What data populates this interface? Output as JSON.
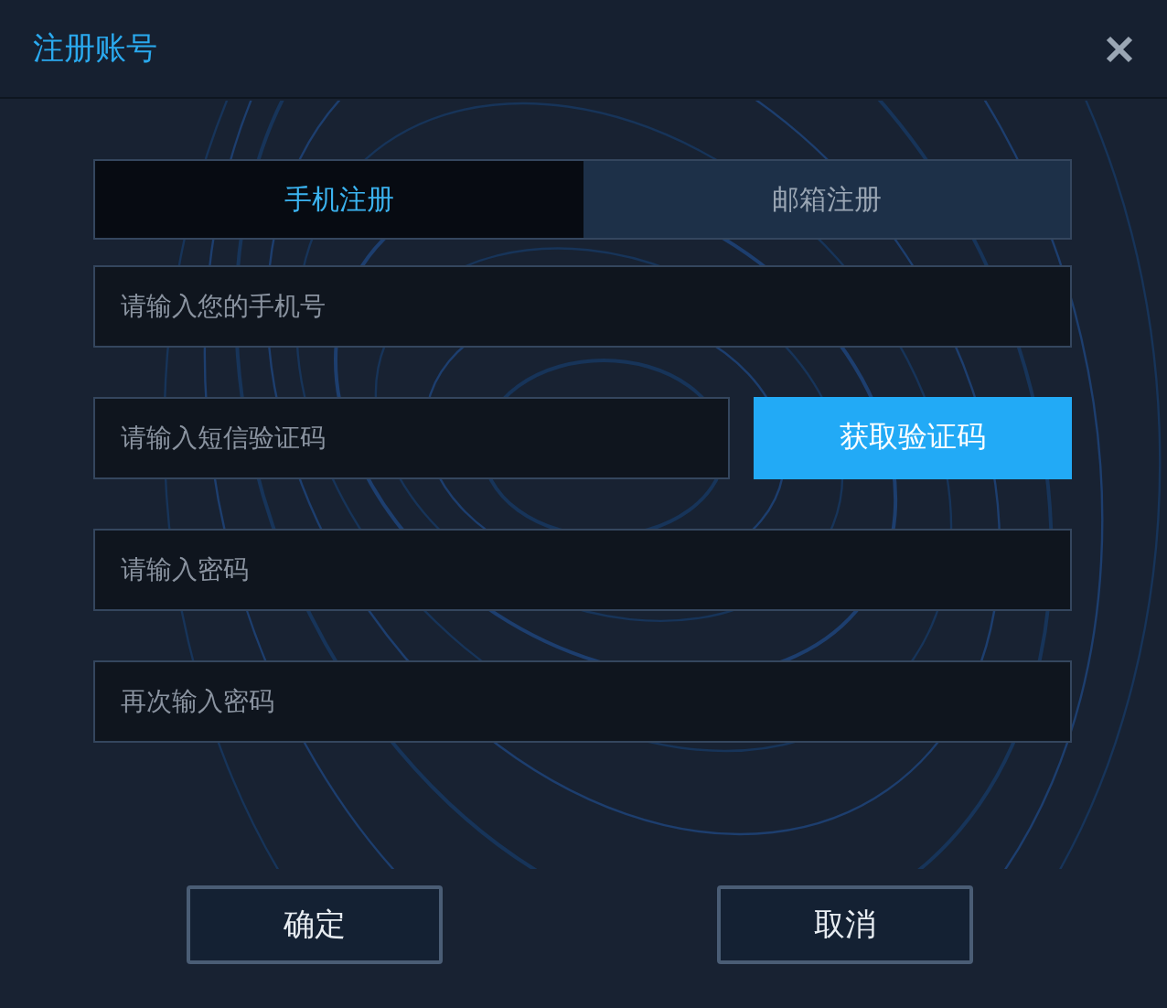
{
  "window": {
    "title": "注册账号"
  },
  "tabs": [
    {
      "label": "手机注册",
      "selected": true
    },
    {
      "label": "邮箱注册",
      "selected": false
    }
  ],
  "fields": [
    {
      "placeholder": "请输入您的手机号"
    },
    {
      "placeholder": "请输入短信验证码",
      "action": "获取验证码"
    },
    {
      "placeholder": "请输入密码"
    },
    {
      "placeholder": "再次输入密码"
    }
  ],
  "buttons": [
    "确定",
    "取消"
  ]
}
